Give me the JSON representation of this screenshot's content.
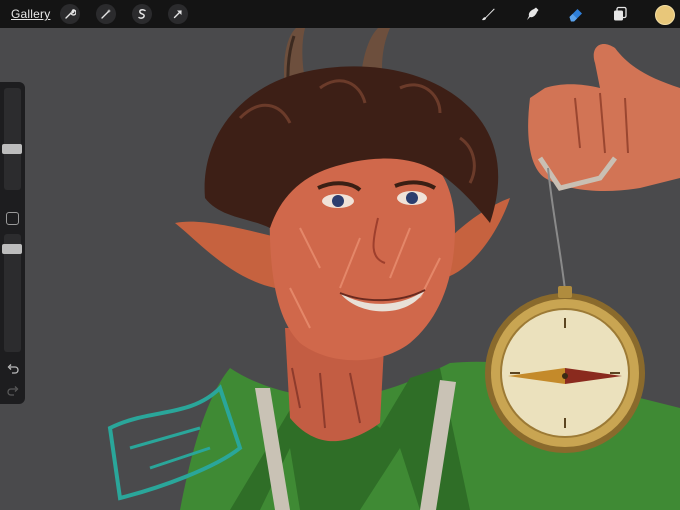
{
  "app": {
    "gallery_label": "Gallery"
  },
  "toolbar_left": {
    "icons": [
      "wrench-icon",
      "magic-wand-icon",
      "selection-s-icon",
      "transform-arrow-icon"
    ]
  },
  "toolbar_right": {
    "icons": [
      "brush-icon",
      "smudge-icon",
      "eraser-icon",
      "layers-icon"
    ],
    "active_tool": "eraser",
    "current_color": "#e8c77a",
    "accent_color": "#2e7fd9"
  },
  "sidebar": {
    "size_slider_level": 0.4,
    "opacity_slider_level": 0.9
  }
}
